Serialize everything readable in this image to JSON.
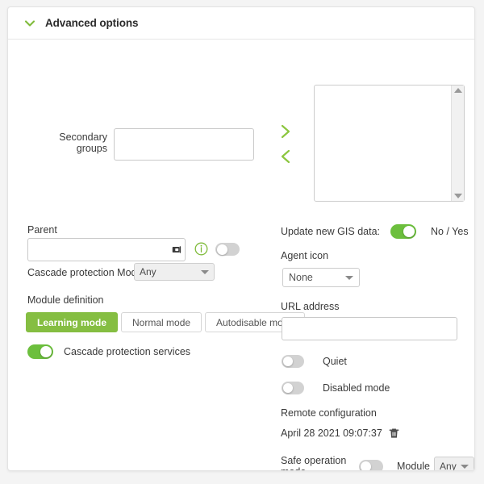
{
  "header": {
    "title": "Advanced options",
    "chevron_icon": "chevron-down-icon",
    "accent_color": "#7fbb3a"
  },
  "colors": {
    "accent_green": "#85be42",
    "toggle_on_green": "#6cbf3d",
    "text": "#3a3a3a",
    "border": "#c9c9c9",
    "page_bg": "#f4f4f4"
  },
  "secondary_groups": {
    "label": "Secondary groups",
    "input_value": "",
    "input_placeholder": "",
    "add_icon": "chevron-right-icon",
    "remove_icon": "chevron-left-icon",
    "listbox_items": [],
    "scroll_up_icon": "triangle-up-icon",
    "scroll_down_icon": "triangle-down-icon"
  },
  "parent": {
    "label": "Parent",
    "input_value": "",
    "input_placeholder": "",
    "copy_icon": "copy-icon",
    "info_icon": "info-icon",
    "toggle_state": "off"
  },
  "cascade_protection_module": {
    "label": "Cascade protection Module",
    "selected": "Any",
    "options": [
      "Any"
    ],
    "caret_icon": "caret-down-icon"
  },
  "module_definition": {
    "label": "Module definition",
    "options": [
      {
        "label": "Learning mode",
        "active": true
      },
      {
        "label": "Normal mode",
        "active": false
      },
      {
        "label": "Autodisable mode",
        "active": false
      }
    ]
  },
  "cascade_protection_services": {
    "label": "Cascade protection services",
    "toggle_state": "on"
  },
  "gis": {
    "label": "Update new GIS data:",
    "toggle_state": "on",
    "values_text": "No / Yes"
  },
  "agent_icon": {
    "label": "Agent icon",
    "selected": "None",
    "options": [
      "None"
    ],
    "caret_icon": "caret-down-icon"
  },
  "url_address": {
    "label": "URL address",
    "input_value": "",
    "input_placeholder": ""
  },
  "quiet": {
    "label": "Quiet",
    "toggle_state": "off"
  },
  "disabled_mode": {
    "label": "Disabled mode",
    "toggle_state": "off"
  },
  "remote_configuration": {
    "label": "Remote configuration",
    "date": "April 28 2021 09:07:37",
    "delete_icon": "trash-icon"
  },
  "safe_operation_mode": {
    "label": "Safe operation mode",
    "toggle_state": "off",
    "module_label": "Module",
    "module_selected": "Any",
    "module_options": [
      "Any"
    ],
    "caret_icon": "caret-down-icon"
  }
}
